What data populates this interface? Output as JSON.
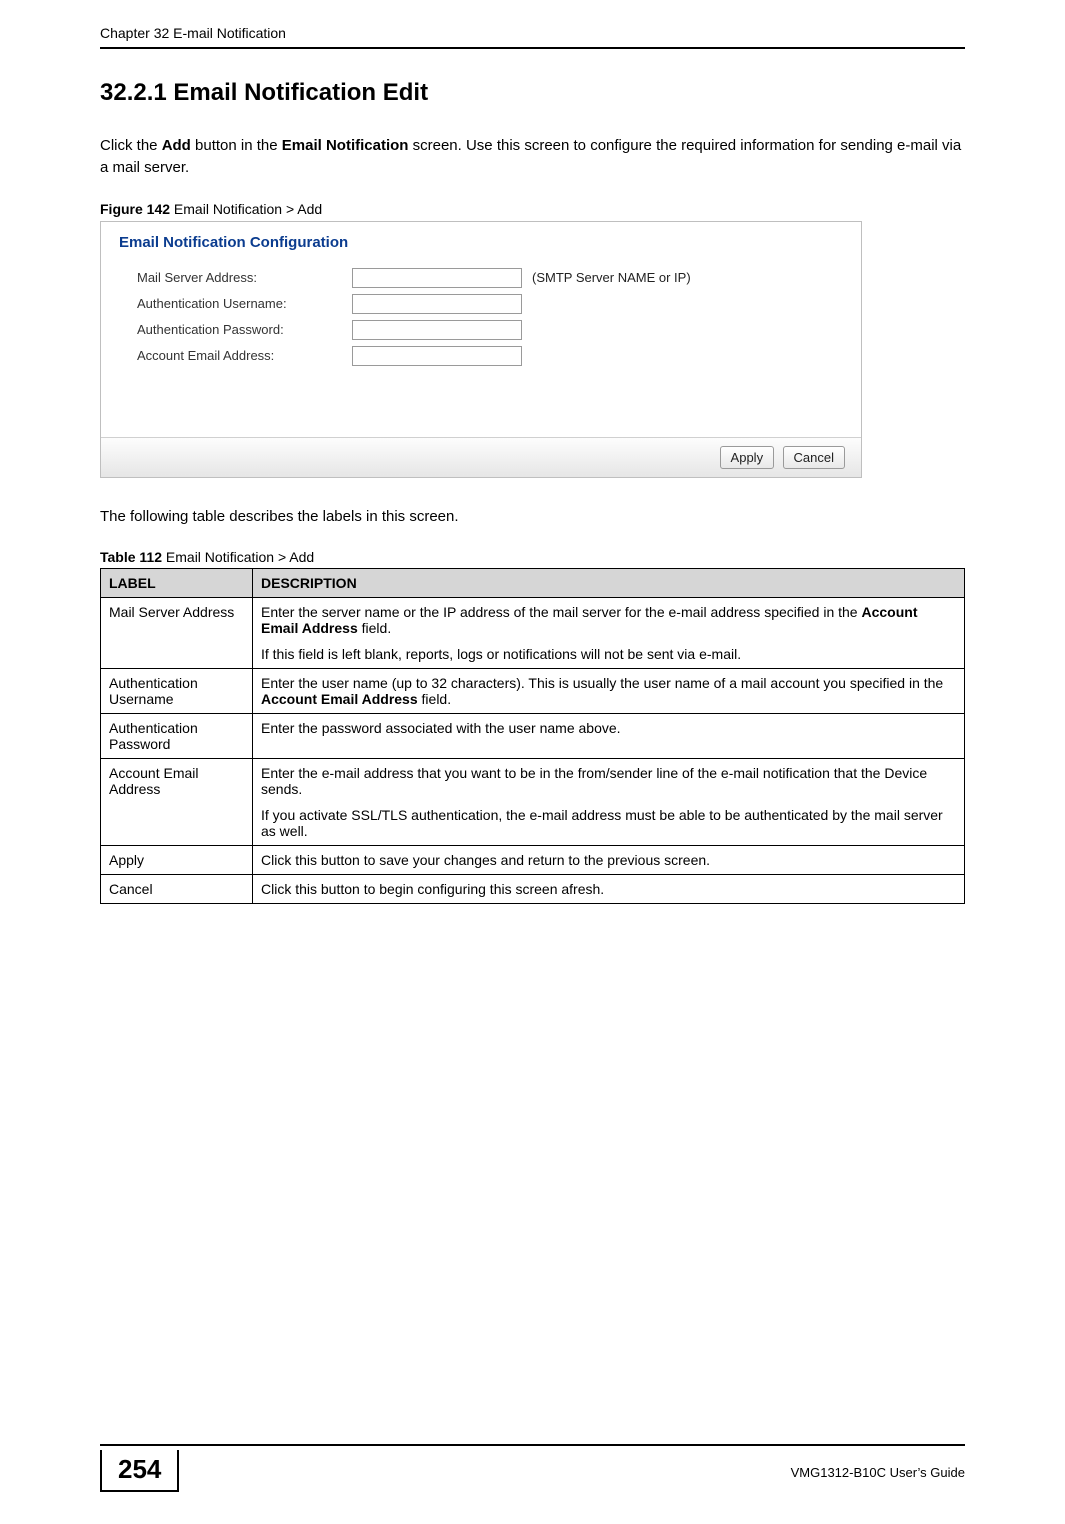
{
  "header": {
    "chapter": "Chapter 32 E-mail Notification"
  },
  "section": {
    "heading": "32.2.1  Email Notification Edit",
    "intro_parts": [
      "Click the ",
      "Add",
      " button in the ",
      "Email Notification",
      " screen. Use this screen to configure the required information for sending e-mail via a mail server."
    ]
  },
  "figure": {
    "label": "Figure 142",
    "caption": "   Email Notification > Add"
  },
  "screenshot": {
    "panel_title": "Email Notification Configuration",
    "rows": [
      {
        "label": "Mail Server Address:",
        "hint": "(SMTP Server NAME or IP)"
      },
      {
        "label": "Authentication Username:",
        "hint": ""
      },
      {
        "label": "Authentication Password:",
        "hint": ""
      },
      {
        "label": "Account Email Address:",
        "hint": ""
      }
    ],
    "buttons": {
      "apply": "Apply",
      "cancel": "Cancel"
    }
  },
  "table_intro": "The following table describes the labels in this screen.",
  "table": {
    "label": "Table 112",
    "caption": "   Email Notification > Add",
    "headers": {
      "label": "LABEL",
      "description": "DESCRIPTION"
    },
    "rows": [
      {
        "label": "Mail Server Address",
        "paras": [
          {
            "parts": [
              "Enter the server name or the IP address of the mail server for the e-mail address specified in the ",
              "Account Email Address",
              " field."
            ]
          },
          {
            "parts": [
              "If this field is left blank, reports, logs or notifications will not be sent via e-mail."
            ]
          }
        ]
      },
      {
        "label": "Authentication Username",
        "paras": [
          {
            "parts": [
              "Enter the user name (up to 32 characters). This is usually the user name of a mail account you specified in the ",
              "Account Email Address",
              " field."
            ]
          }
        ]
      },
      {
        "label": "Authentication Password",
        "paras": [
          {
            "parts": [
              "Enter the password associated with the user name above."
            ]
          }
        ]
      },
      {
        "label": "Account Email Address",
        "paras": [
          {
            "parts": [
              "Enter the e-mail address that you want to be in the from/sender line of the e-mail notification that the Device sends."
            ]
          },
          {
            "parts": [
              "If you activate SSL/TLS authentication, the e-mail address must be able to be authenticated by the mail server as well."
            ]
          }
        ]
      },
      {
        "label": "Apply",
        "paras": [
          {
            "parts": [
              "Click this button to save your changes and return to the previous screen."
            ]
          }
        ]
      },
      {
        "label": "Cancel",
        "paras": [
          {
            "parts": [
              "Click this button to begin configuring this screen afresh."
            ]
          }
        ]
      }
    ]
  },
  "footer": {
    "page_number": "254",
    "guide": "VMG1312-B10C User’s Guide"
  }
}
